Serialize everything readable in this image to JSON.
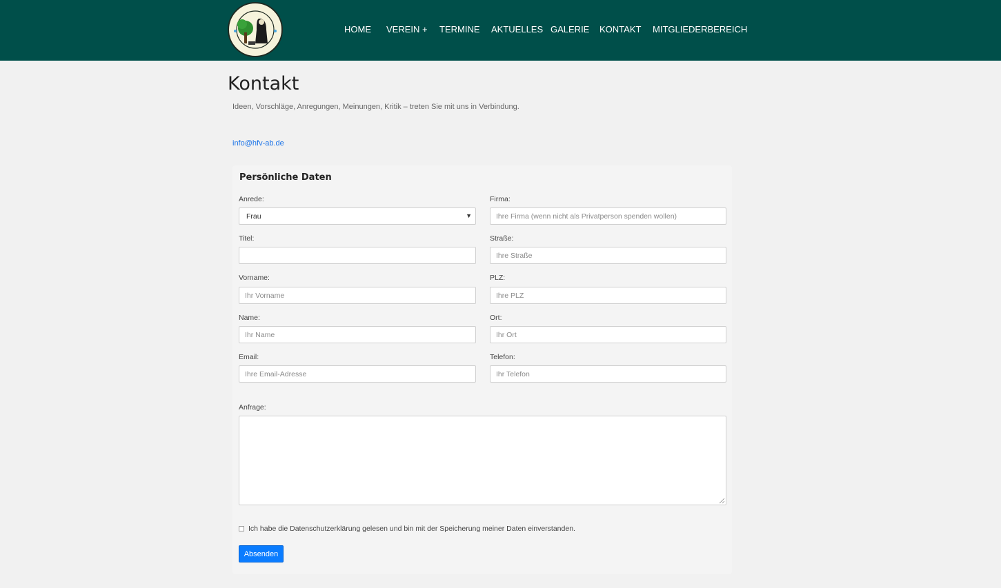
{
  "header": {
    "brand_color": "#004f4a",
    "nav": [
      {
        "label": "HOME"
      },
      {
        "label": "VEREIN +"
      },
      {
        "label": "TERMINE"
      },
      {
        "label": "AKTUELLES"
      },
      {
        "label": "GALERIE"
      },
      {
        "label": "KONTAKT"
      },
      {
        "label": "MITGLIEDERBEREICH"
      }
    ]
  },
  "page": {
    "title": "Kontakt",
    "lead": "Ideen, Vorschläge, Anregungen, Meinungen, Kritik – treten Sie mit uns in Verbindung.",
    "email": "info@hfv-ab.de"
  },
  "form": {
    "section_title": "Persönliche Daten",
    "anrede": {
      "label": "Anrede:",
      "value": "Frau"
    },
    "firma": {
      "label": "Firma:",
      "placeholder": "Ihre Firma (wenn nicht als Privatperson spenden wollen)"
    },
    "titel": {
      "label": "Titel:",
      "placeholder": ""
    },
    "strasse": {
      "label": "Straße:",
      "placeholder": "Ihre Straße"
    },
    "vorname": {
      "label": "Vorname:",
      "placeholder": "Ihr Vorname"
    },
    "plz": {
      "label": "PLZ:",
      "placeholder": "Ihre PLZ"
    },
    "name": {
      "label": "Name:",
      "placeholder": "Ihr Name"
    },
    "ort": {
      "label": "Ort:",
      "placeholder": "Ihr Ort"
    },
    "email": {
      "label": "Email:",
      "placeholder": "Ihre Email-Adresse"
    },
    "telefon": {
      "label": "Telefon:",
      "placeholder": "Ihr Telefon"
    },
    "anfrage": {
      "label": "Anfrage:"
    },
    "consent": "Ich habe die Datenschutzerklärung gelesen und bin mit der Speicherung meiner Daten einverstanden.",
    "submit": "Absenden",
    "accent_color": "#0a7cff"
  },
  "icons": {
    "logo": "club-logo-icon",
    "select_caret": "caret-down-icon"
  }
}
